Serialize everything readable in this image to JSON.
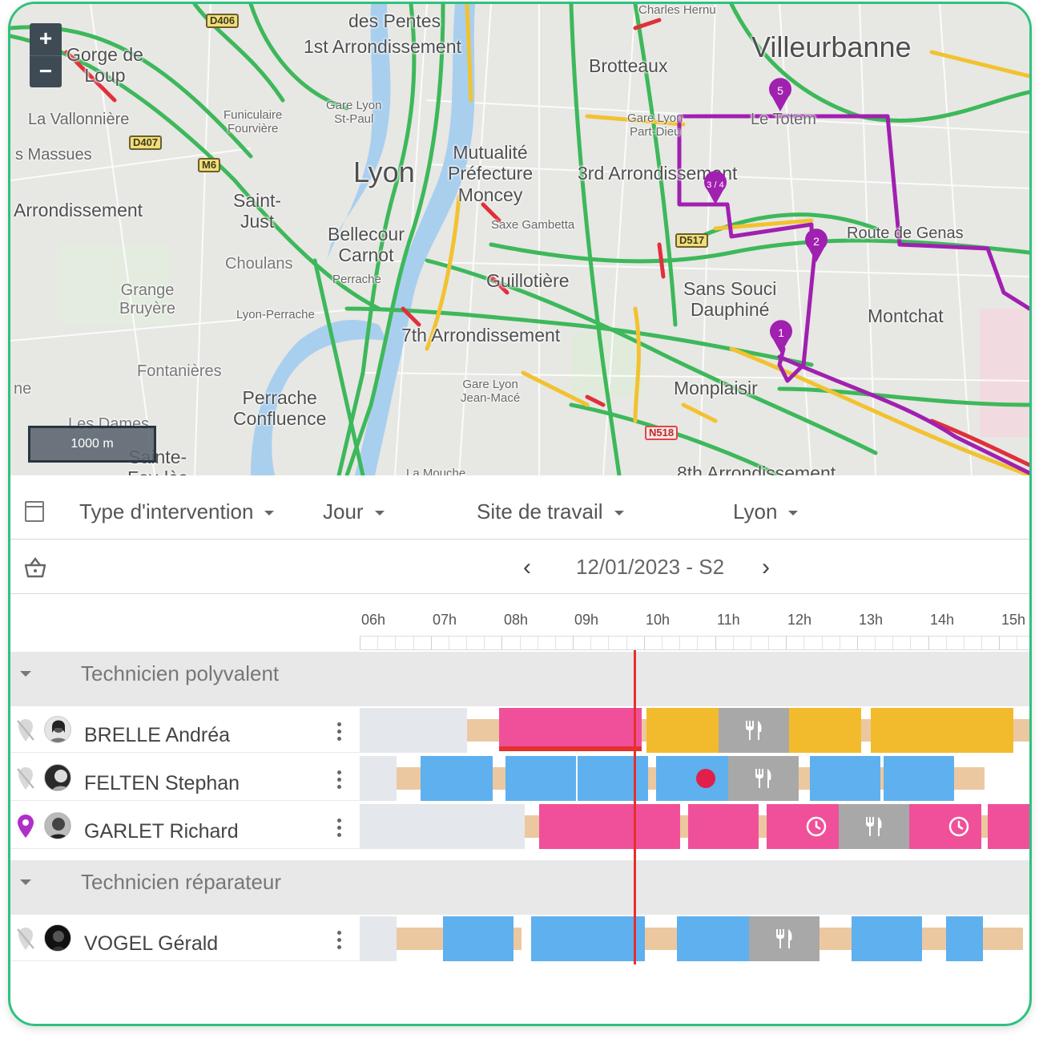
{
  "map": {
    "zoom_in": "+",
    "zoom_out": "−",
    "scale": "1000 m",
    "labels": {
      "villeurbanne": "Villeurbanne",
      "lyon": "Lyon",
      "brotteaux": "Brotteaux",
      "des_pentes": "des Pentes",
      "first_arr": "1st Arrondissement",
      "gorge_de_loup": "Gorge de\nLoup",
      "la_vallonniere": "La Vallonnière",
      "funiculaire": "Funiculaire\nFourvière",
      "gare_st_paul": "Gare Lyon\nSt-Paul",
      "massues": "s Massues",
      "mutualite": "Mutualité\nPréfecture\nMoncey",
      "third_arr": "3rd Arrondissement",
      "gare_part_dieu": "Gare Lyon\nPart-Dieu",
      "le_totem": "Le Totem",
      "fifth_arr": "Arrondissement",
      "saint_just": "Saint-\nJust",
      "bellecour": "Bellecour\nCarnot",
      "saxe_gambetta": "Saxe Gambetta",
      "route_genas": "Route de Genas",
      "choulans": "Choulans",
      "perrache": "Perrache",
      "guillotiere": "Guillotière",
      "sans_souci": "Sans Souci\nDauphiné",
      "montchat": "Montchat",
      "grange_bruyere": "Grange\nBruyère",
      "lyon_perrache": "Lyon-Perrache",
      "seventh_arr": "7th Arrondissement",
      "fontanieres": "Fontanières",
      "perrache_confluence": "Perrache\nConfluence",
      "gare_jean_mace": "Gare Lyon\nJean-Macé",
      "monplaisir": "Monplaisir",
      "les_dames": "Les Dames",
      "sainte_foy": "Sainte-\nFoy-lès",
      "ne": "ne",
      "la_mouche": "La Mouche",
      "eighth_arr": "8th Arrondissement",
      "charles_hernu": "Charles Hernu"
    },
    "shields": {
      "d406": "D406",
      "d407": "D407",
      "m6": "M6",
      "d517": "D517",
      "n518": "N518"
    },
    "markers": [
      "5",
      "3 / 4",
      "2",
      "1"
    ],
    "route_color": "#a020b0",
    "traffic_colors": {
      "free": "#3db85a",
      "slow": "#f2c230",
      "jam": "#e0303a"
    }
  },
  "filters": {
    "type": "Type d'intervention",
    "period": "Jour",
    "site": "Site de travail",
    "city": "Lyon"
  },
  "date_nav": {
    "label": "12/01/2023 - S2",
    "prev": "‹",
    "next": "›"
  },
  "timeline": {
    "hours": [
      "06h",
      "07h",
      "08h",
      "09h",
      "10h",
      "11h",
      "12h",
      "13h",
      "14h",
      "15h"
    ]
  },
  "groups": [
    {
      "label": "Technicien polyvalent",
      "technicians": [
        {
          "name": "BRELLE Andréa",
          "located": false
        },
        {
          "name": "FELTEN Stephan",
          "located": false
        },
        {
          "name": "GARLET Richard",
          "located": true
        }
      ]
    },
    {
      "label": "Technicien réparateur",
      "technicians": [
        {
          "name": "VOGEL Gérald",
          "located": false
        }
      ]
    }
  ],
  "colors": {
    "pink": "#f0509a",
    "yellow": "#f2bb2e",
    "blue": "#5eb0ef",
    "gray": "#a8a8a8",
    "tan": "#ecc8a0",
    "now": "#e53030",
    "border": "#2ec27e"
  },
  "icons": [
    "calendar-icon",
    "basket-icon",
    "fork-knife-icon",
    "clock-icon",
    "pin-off-icon",
    "pin-icon",
    "kebab-icon"
  ]
}
